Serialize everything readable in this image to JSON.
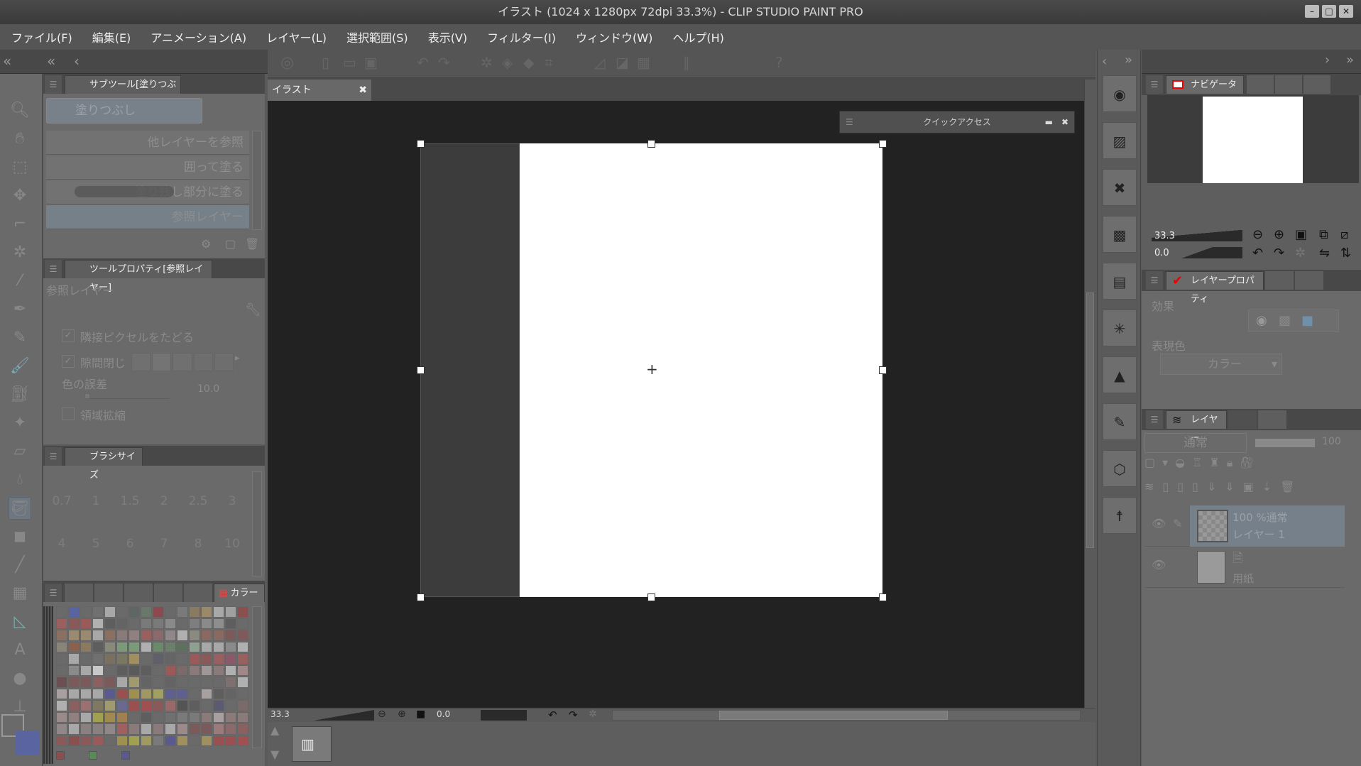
{
  "window": {
    "title": "イラスト (1024 x 1280px 72dpi 33.3%) - CLIP STUDIO PAINT PRO"
  },
  "menu": [
    "ファイル(F)",
    "編集(E)",
    "アニメーション(A)",
    "レイヤー(L)",
    "選択範囲(S)",
    "表示(V)",
    "フィルター(I)",
    "ウィンドウ(W)",
    "ヘルプ(H)"
  ],
  "subtool": {
    "tab": "サブツール[塗りつぶし]",
    "group": "塗りつぶし",
    "items": [
      "他レイヤーを参照",
      "囲って塗る",
      "塗り残し部分に塗る",
      "参照レイヤー"
    ]
  },
  "toolprop": {
    "tab": "ツールプロパティ[参照レイヤー]",
    "name": "参照レイヤー",
    "adjacent": "隣接ピクセルをたどる",
    "gap": "隙間閉じ",
    "tolerance_label": "色の誤差",
    "tolerance_value": "10.0",
    "expand": "領域拡縮"
  },
  "brushsize": {
    "tab": "ブラシサイズ",
    "sizes": [
      "0.7",
      "1",
      "1.5",
      "2",
      "2.5",
      "3",
      "4",
      "5",
      "6",
      "7",
      "8",
      "10"
    ]
  },
  "color": {
    "tab": "カラー",
    "palette": [
      "#6a6a6a",
      "#5a64a0",
      "#6a6a6a",
      "#707070",
      "#a8a8a8",
      "#6a6a6a",
      "#5e6666",
      "#6a786a",
      "#8a4a50",
      "#6a6a6a",
      "#7a7a7a",
      "#8a7a60",
      "#9a8a6a",
      "#a8a8a8",
      "#a0a0a0",
      "#8a5050",
      "#9a6060",
      "#8a5a5a",
      "#9a5a5a",
      "#b0b0b0",
      "#5e5e5e",
      "#646464",
      "#6a6a6a",
      "#7a7a7a",
      "#7a7a7a",
      "#8a8a8a",
      "#6a6a6a",
      "#7e7e7e",
      "#8a8a8a",
      "#8e8e8e",
      "#5e5e5e",
      "#6a6a6a",
      "#8a7060",
      "#9a8a70",
      "#9a8a70",
      "#a8a8a8",
      "#8a7060",
      "#8a7a7a",
      "#908080",
      "#9a6060",
      "#8a6a6a",
      "#908888",
      "#b0b0b0",
      "#8a8a80",
      "#8a6a60",
      "#8a6a60",
      "#7a5a5a",
      "#7e5a5a",
      "#8a8478",
      "#8a6050",
      "#8a7a60",
      "#5e5e5e",
      "#8a8a7a",
      "#7a9a7a",
      "#7a9a7a",
      "#b0b0b0",
      "#6a8a6a",
      "#6a806a",
      "#5e705e",
      "#90a090",
      "#a8a8a8",
      "#a8a8a8",
      "#8a8a8a",
      "#b0b0b0",
      "#6a6a6a",
      "#a8a8a8",
      "#6a6a6a",
      "#707070",
      "#7a7060",
      "#7a7860",
      "#a09060",
      "#6a6a6a",
      "#60606a",
      "#646464",
      "#6a6a6a",
      "#9a5a5a",
      "#8a5a5a",
      "#9a6060",
      "#8a5a6a",
      "#9a6060",
      "#6a6a6a",
      "#8a8a8a",
      "#a8a8a8",
      "#c8c8c8",
      "#6a6a6a",
      "#5e5e5e",
      "#5a5a5a",
      "#5e5e5e",
      "#6a6a6a",
      "#9a5a5a",
      "#7a6a6a",
      "#8a7a7a",
      "#a09898",
      "#8a7a7a",
      "#b0b0b0",
      "#a08888",
      "#6a5050",
      "#7a5a5a",
      "#7a5a5a",
      "#8a6060",
      "#7a5a5a",
      "#a8a8a8",
      "#a09a70",
      "#646464",
      "#6a6a6a",
      "#646464",
      "#6a6a6a",
      "#6a6a6a",
      "#6a6a6a",
      "#6a6a6a",
      "#7e7070",
      "#b0b0b0",
      "#a8a0a0",
      "#a8a8a8",
      "#a8a8a8",
      "#a8a8a8",
      "#5a5a90",
      "#9a5050",
      "#a09050",
      "#a09860",
      "#a0a060",
      "#606090",
      "#606090",
      "#6a6a6a",
      "#a8a0a0",
      "#5e5e5e",
      "#646464",
      "#6a6a6a",
      "#b0b0b0",
      "#8a6060",
      "#9a7070",
      "#807860",
      "#a09a70",
      "#6a6a90",
      "#9a5050",
      "#a05050",
      "#8a5a5a",
      "#9a6a6a",
      "#545454",
      "#5e5e5e",
      "#6a6a6a",
      "#5a5a70",
      "#6a6a6a",
      "#7a6a6a",
      "#9a8a8a",
      "#908080",
      "#a8a8a8",
      "#a0a050",
      "#a08a50",
      "#a08050",
      "#6a6a6a",
      "#5e5e5e",
      "#6a6a6a",
      "#707070",
      "#7a7a7a",
      "#7a7a7a",
      "#8a7a7a",
      "#a8a0a0",
      "#8a7a7a",
      "#8a7a7a",
      "#908888",
      "#a8a8a8",
      "#8a8080",
      "#8a8080",
      "#908888",
      "#a06060",
      "#8a7a7a",
      "#a8a8a8",
      "#8a7a7a",
      "#a8a8a8",
      "#9a8a8a",
      "#7a5a5a",
      "#7a5a5a",
      "#9a7a7a",
      "#8a6a6a",
      "#8a6060",
      "#8a5a5a",
      "#8a5050",
      "#8a5a5a",
      "#9a5a5a",
      "#6a6a6a",
      "#a09050",
      "#a0a050",
      "#a09a60",
      "#7a7a7a",
      "#5a5a90",
      "#a09060",
      "#6a6a6a",
      "#a09060",
      "#9a5050",
      "#9a5050",
      "#a05050"
    ],
    "recent": [
      "#8a5050",
      "#5a8a5a",
      "#5a5a90"
    ],
    "main_color": "#6a6a6a",
    "sub_color": "#5a64a0"
  },
  "canvas": {
    "tab": "イラスト",
    "quick_access": "クイックアクセス",
    "zoom": "33.3",
    "angle": "0.0"
  },
  "navigator": {
    "tab": "ナビゲーター",
    "zoom": "33.3",
    "angle": "0.0"
  },
  "layerprop": {
    "tab": "レイヤープロパティ",
    "effect": "効果",
    "expression": "表現色",
    "color_mode": "カラー"
  },
  "layers": {
    "tab": "レイヤー",
    "blend": "通常",
    "opacity": "100",
    "items": [
      {
        "meta": "100 %通常",
        "name": "レイヤー 1"
      },
      {
        "name": "用紙"
      }
    ]
  }
}
